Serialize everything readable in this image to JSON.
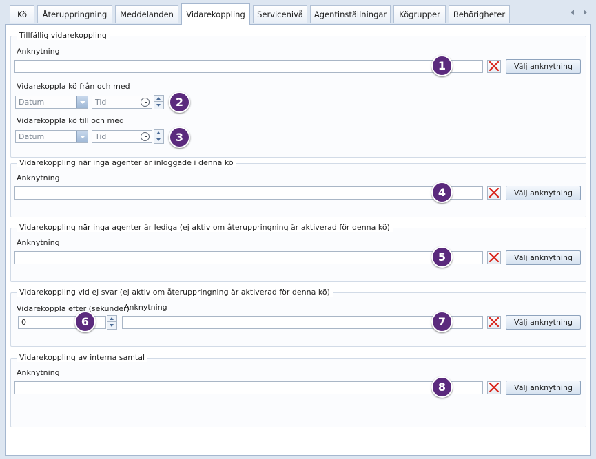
{
  "tabs": [
    {
      "label": "Kö",
      "active": false
    },
    {
      "label": "Återuppringning",
      "active": false
    },
    {
      "label": "Meddelanden",
      "active": false
    },
    {
      "label": "Vidarekoppling",
      "active": true
    },
    {
      "label": "Servicenivå",
      "active": false
    },
    {
      "label": "Agentinställningar",
      "active": false
    },
    {
      "label": "Kögrupper",
      "active": false
    },
    {
      "label": "Behörigheter",
      "active": false
    }
  ],
  "common": {
    "extension_label": "Anknytning",
    "select_extension_button": "Välj anknytning",
    "date_placeholder": "Datum",
    "time_placeholder": "Tid"
  },
  "group_temporary": {
    "title": "Tillfällig vidarekoppling",
    "extension_value": "",
    "from_label": "Vidarekoppla kö från och med",
    "to_label": "Vidarekoppla kö till och med"
  },
  "group_no_logged_in": {
    "title": "Vidarekoppling när inga agenter är inloggade i denna kö",
    "extension_value": ""
  },
  "group_no_free": {
    "title": "Vidarekoppling när inga agenter är lediga  (ej aktiv om återuppringning är aktiverad för denna kö)",
    "extension_value": ""
  },
  "group_no_answer": {
    "title": "Vidarekoppling vid ej svar (ej aktiv om återuppringning är aktiverad för denna kö)",
    "seconds_label": "Vidarekoppla efter (sekunder)",
    "seconds_value": "0",
    "extension_value": ""
  },
  "group_internal": {
    "title": "Vidarekoppling av interna samtal",
    "extension_value": ""
  },
  "markers": [
    "1",
    "2",
    "3",
    "4",
    "5",
    "6",
    "7",
    "8"
  ],
  "colors": {
    "accent_marker": "#5b2a7d",
    "clear_x": "#d8231a",
    "window_bg": "#dde6f1"
  }
}
